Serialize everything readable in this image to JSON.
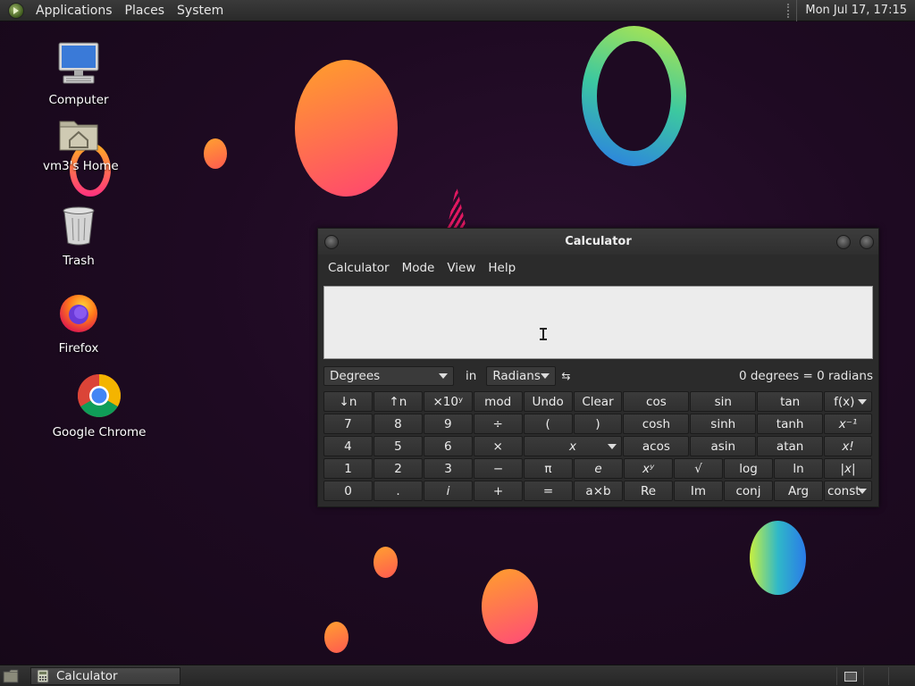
{
  "top_panel": {
    "menus": [
      "Applications",
      "Places",
      "System"
    ],
    "clock": "Mon Jul 17, 17:15"
  },
  "desktop": {
    "icons": [
      {
        "label": "Computer",
        "icon": "computer-icon"
      },
      {
        "label": "vm3's Home",
        "icon": "home-folder-icon"
      },
      {
        "label": "Trash",
        "icon": "trash-icon"
      },
      {
        "label": "Firefox",
        "icon": "firefox-icon"
      },
      {
        "label": "Google Chrome",
        "icon": "chrome-icon"
      }
    ]
  },
  "window": {
    "title": "Calculator",
    "menu": [
      "Calculator",
      "Mode",
      "View",
      "Help"
    ],
    "display_value": "",
    "conversion": {
      "from_unit": "Degrees",
      "in_label": "in",
      "to_unit": "Radians",
      "swap_icon": "swap-arrows-icon",
      "result": "0 degrees = 0 radians"
    },
    "keypad": {
      "rows": [
        [
          "↓n",
          "↑n",
          "×10ʸ",
          "mod",
          "Undo",
          "Clear",
          "cos",
          "sin",
          "tan",
          "f(x)"
        ],
        [
          "7",
          "8",
          "9",
          "÷",
          "(",
          ")",
          "cosh",
          "sinh",
          "tanh",
          "x⁻¹"
        ],
        [
          "4",
          "5",
          "6",
          "×",
          "x",
          "acos",
          "asin",
          "atan",
          "x!"
        ],
        [
          "1",
          "2",
          "3",
          "−",
          "π",
          "e",
          "xʸ",
          "√",
          "log",
          "ln",
          "|x|"
        ],
        [
          "0",
          ".",
          "i",
          "+",
          "=",
          "a×b",
          "Re",
          "Im",
          "conj",
          "Arg",
          "const"
        ]
      ]
    }
  },
  "taskbar": {
    "tasks": [
      {
        "label": "Calculator"
      }
    ]
  },
  "colors": {
    "desktop_bg": "#1e0a22",
    "panel_bg": "#2e2e2e",
    "window_bg": "#2b2b2b",
    "display_bg": "#ececec"
  }
}
